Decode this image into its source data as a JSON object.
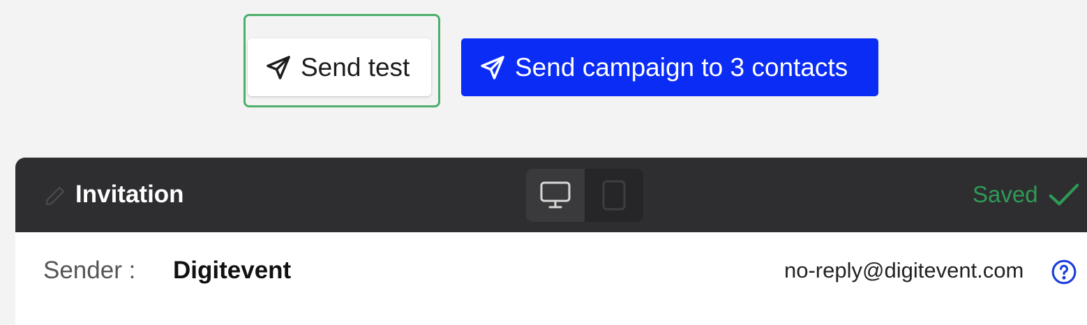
{
  "actions": {
    "send_test_label": "Send test",
    "send_campaign_label": "Send campaign to 3 contacts",
    "icons": [
      "paper-plane-icon",
      "paper-plane-icon"
    ]
  },
  "editor": {
    "title": "Invitation",
    "saved_label": "Saved",
    "device_options": [
      "desktop",
      "mobile"
    ],
    "selected_device": "desktop"
  },
  "sender": {
    "label": "Sender :",
    "name": "Digitevent",
    "email": "no-reply@digitevent.com"
  },
  "colors": {
    "primary_button": "#0a2cf5",
    "highlight_outline": "#4caf6a",
    "header_background": "#2e2e31",
    "saved_status": "#2f9a55",
    "help_icon": "#1a3ed8",
    "page_background": "#f3f3f3"
  }
}
